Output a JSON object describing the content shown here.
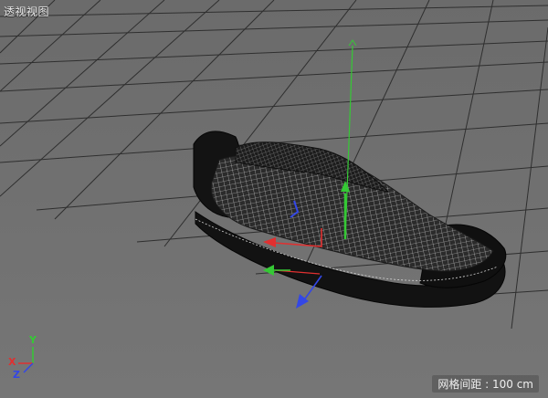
{
  "viewport": {
    "title": "透视视图",
    "grid_spacing": "网格间距 : 100 cm"
  },
  "axes_indicator": {
    "x_label": "X",
    "y_label": "Y",
    "z_label": "Z"
  },
  "colors": {
    "background": "#6f6f6f",
    "grid": "#2f2f2f",
    "x_axis": "#e03030",
    "y_axis": "#35c935",
    "z_axis": "#3347e6",
    "mesh_dark": "#151515"
  },
  "object": {
    "icon": "shoe-mesh-object"
  }
}
